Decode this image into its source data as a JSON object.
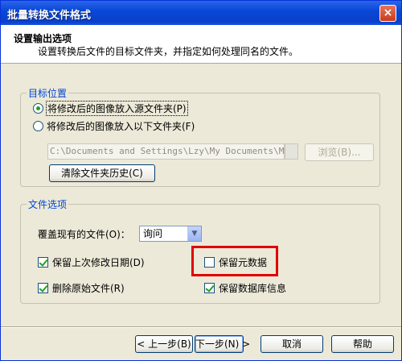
{
  "window": {
    "title": "批量转换文件格式",
    "close_icon": "×"
  },
  "header": {
    "title": "设置输出选项",
    "subtitle": "设置转换后文件的目标文件夹，并指定如何处理同名的文件。"
  },
  "target": {
    "legend": "目标位置",
    "option_source": "将修改后的图像放入源文件夹(P)",
    "option_folder": "将修改后的图像放入以下文件夹(F)",
    "path_value": "C:\\Documents and Settings\\Lzy\\My Documents\\My Pi",
    "browse_label": "浏览(B)...",
    "clear_history_label": "清除文件夹历史(C)"
  },
  "file_options": {
    "legend": "文件选项",
    "overwrite_label": "覆盖现有的文件(O)：",
    "overwrite_value": "询问",
    "keep_modified_date": "保留上次修改日期(D)",
    "keep_metadata": "保留元数据",
    "delete_original": "删除原始文件(R)",
    "keep_db_info": "保留数据库信息"
  },
  "footer": {
    "back": "< 上一步(B)",
    "next": "下一步(N) >",
    "cancel": "取消",
    "help": "帮助"
  }
}
